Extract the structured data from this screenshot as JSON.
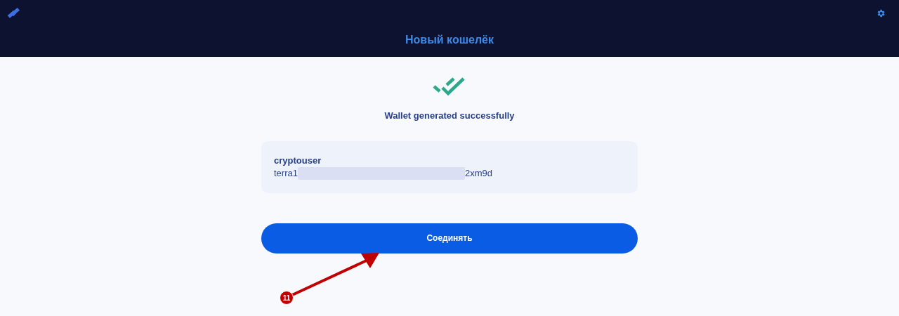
{
  "header": {
    "title": "Новый кошелёк"
  },
  "status": {
    "message": "Wallet generated successfully"
  },
  "wallet": {
    "name": "cryptouser",
    "address_start": "terra1",
    "address_end": "2xm9d"
  },
  "connect_button": {
    "label": "Соединять"
  },
  "annotation": {
    "label": "11"
  }
}
